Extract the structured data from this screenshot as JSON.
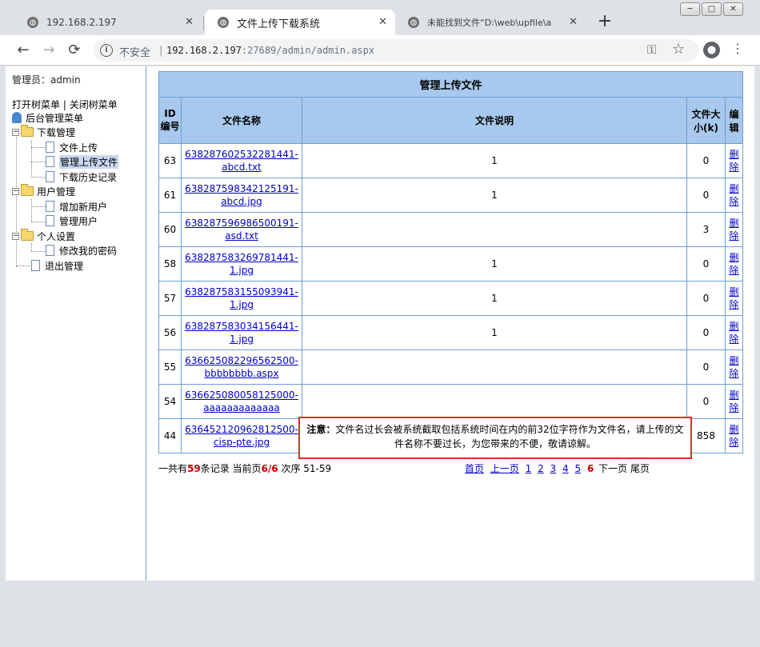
{
  "browser": {
    "tabs": [
      {
        "label": "192.168.2.197",
        "active": false
      },
      {
        "label": "文件上传下载系统",
        "active": true
      },
      {
        "label": "未能找到文件“D:\\web\\upfile\\a",
        "active": false
      }
    ],
    "new_tab": "+",
    "window_controls": [
      "─",
      "□",
      "✕"
    ],
    "nav": {
      "back": "←",
      "forward": "→",
      "reload": "⟳"
    },
    "omnibox": {
      "insecure_label": "不安全",
      "separator": "|",
      "url_host": "192.168.2.197",
      "url_rest": ":27689/admin/admin.aspx"
    }
  },
  "sidebar": {
    "admin_label": "管理员：admin",
    "open_tree": "打开树菜单",
    "tree_sep": "|",
    "close_tree": "关闭树菜单",
    "root": "后台管理菜单",
    "groups": [
      {
        "label": "下载管理",
        "items": [
          "文件上传",
          "管理上传文件",
          "下载历史记录"
        ]
      },
      {
        "label": "用户管理",
        "items": [
          "增加新用户",
          "管理用户"
        ]
      },
      {
        "label": "个人设置",
        "items": [
          "修改我的密码"
        ]
      }
    ],
    "exit": "退出管理",
    "selected_item": "管理上传文件"
  },
  "table": {
    "caption": "管理上传文件",
    "headers": {
      "id": "ID编号",
      "name": "文件名称",
      "desc": "文件说明",
      "size": "文件大小(k)",
      "edit": "编辑"
    },
    "rows": [
      {
        "id": "63",
        "name": "638287602532281441-abcd.txt",
        "desc": "1",
        "size": "0",
        "action": "删除"
      },
      {
        "id": "61",
        "name": "638287598342125191-abcd.jpg",
        "desc": "1",
        "size": "0",
        "action": "删除"
      },
      {
        "id": "60",
        "name": "638287596986500191-asd.txt",
        "desc": "",
        "size": "3",
        "action": "删除"
      },
      {
        "id": "58",
        "name": "638287583269781441-1.jpg",
        "desc": "1",
        "size": "0",
        "action": "删除"
      },
      {
        "id": "57",
        "name": "638287583155093941-1.jpg",
        "desc": "1",
        "size": "0",
        "action": "删除"
      },
      {
        "id": "56",
        "name": "638287583034156441-1.jpg",
        "desc": "1",
        "size": "0",
        "action": "删除"
      },
      {
        "id": "55",
        "name": "636625082296562500-bbbbbbbb.aspx",
        "desc": "",
        "size": "0",
        "action": "删除"
      },
      {
        "id": "54",
        "name": "636625080058125000-aaaaaaaaaaaaa",
        "desc": "",
        "size": "0",
        "action": "删除"
      },
      {
        "id": "44",
        "name": "636452120962812500-cisp-pte.jpg",
        "desc": "",
        "size": "858",
        "action": "删除"
      }
    ]
  },
  "pager": {
    "total_prefix": "一共有",
    "total": "59",
    "total_suffix": "条记录 当前页",
    "current": "6/6",
    "range": " 次序 51-59",
    "first": "首页",
    "prev": "上一页",
    "pages": [
      "1",
      "2",
      "3",
      "4",
      "5"
    ],
    "current_page": "6",
    "next": "下一页",
    "last": "尾页"
  },
  "note": {
    "label": "注意：",
    "text": "文件名过长会被系统截取包括系统时间在内的前32位字符作为文件名，请上传的文件名称不要过长，为您带来的不便，敬请谅解。"
  },
  "colors": {
    "header_bg": "#a8c8ed",
    "border": "#6a9fd3",
    "link": "#0000cc",
    "highlight_red": "#cc0000",
    "note_border": "#e32a2a"
  }
}
